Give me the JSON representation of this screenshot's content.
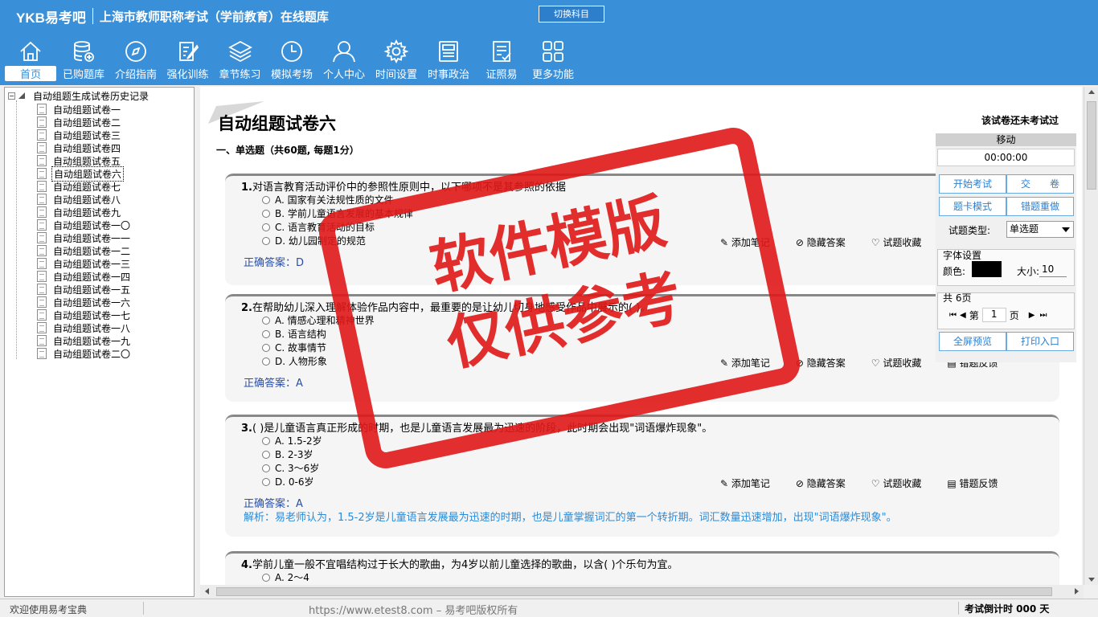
{
  "app": {
    "brand": "YKB易考吧",
    "title": "上海市教师职称考试（学前教育）在线题库",
    "switch_label": "切换科目"
  },
  "toolbar": [
    {
      "label": "首页",
      "icon": "home-icon"
    },
    {
      "label": "已购题库",
      "icon": "database-icon"
    },
    {
      "label": "介绍指南",
      "icon": "compass-icon"
    },
    {
      "label": "强化训练",
      "icon": "edit-icon"
    },
    {
      "label": "章节练习",
      "icon": "layers-icon"
    },
    {
      "label": "模拟考场",
      "icon": "clock-icon"
    },
    {
      "label": "个人中心",
      "icon": "user-icon"
    },
    {
      "label": "时间设置",
      "icon": "gear-icon"
    },
    {
      "label": "时事政治",
      "icon": "news-icon"
    },
    {
      "label": "证照易",
      "icon": "checklist-icon"
    },
    {
      "label": "更多功能",
      "icon": "grid-icon"
    }
  ],
  "tree": {
    "root": "自动组题生成试卷历史记录",
    "items": [
      "自动组题试卷一",
      "自动组题试卷二",
      "自动组题试卷三",
      "自动组题试卷四",
      "自动组题试卷五",
      "自动组题试卷六",
      "自动组题试卷七",
      "自动组题试卷八",
      "自动组题试卷九",
      "自动组题试卷一〇",
      "自动组题试卷一一",
      "自动组题试卷一二",
      "自动组题试卷一三",
      "自动组题试卷一四",
      "自动组题试卷一五",
      "自动组题试卷一六",
      "自动组题试卷一七",
      "自动组题试卷一八",
      "自动组题试卷一九",
      "自动组题试卷二〇"
    ],
    "selected_index": 5
  },
  "paper": {
    "title": "自动组题试卷六",
    "status": "该试卷还未考试过",
    "section": "一、单选题（共60题, 每题1分）"
  },
  "question_actions": {
    "note": "添加笔记",
    "hide": "隐藏答案",
    "fav": "试题收藏",
    "report": "错题反馈"
  },
  "questions": [
    {
      "num": "1.",
      "stem": "对语言教育活动评价中的参照性原则中，以下哪项不是其参照的依据",
      "options": [
        "A. 国家有关法规性质的文件",
        "B. 学前儿童语言发展的基本规律",
        "C. 语言教育活动的目标",
        "D. 幼儿园制定的规范"
      ],
      "answer_label": "正确答案：",
      "answer": "D",
      "explain": ""
    },
    {
      "num": "2.",
      "stem": "在帮助幼儿深入理解体验作品内容中，最重要的是让幼儿切身地感受作品中展示的( )。",
      "options": [
        "A. 情感心理和精神世界",
        "B. 语言结构",
        "C. 故事情节",
        "D. 人物形象"
      ],
      "answer_label": "正确答案：",
      "answer": "A",
      "explain": ""
    },
    {
      "num": "3.",
      "stem": "( )是儿童语言真正形成的时期，也是儿童语言发展最为迅速的阶段，此时期会出现\"词语爆炸现象\"。",
      "options": [
        "A. 1.5-2岁",
        "B. 2-3岁",
        "C. 3～6岁",
        "D. 0-6岁"
      ],
      "answer_label": "正确答案：",
      "answer": "A",
      "explain": "解析：易老师认为，1.5-2岁是儿童语言发展最为迅速的时期，也是儿童掌握词汇的第一个转折期。词汇数量迅速增加，出现\"词语爆炸现象\"。"
    },
    {
      "num": "4.",
      "stem": "学前儿童一般不宜唱结构过于长大的歌曲，为4岁以前儿童选择的歌曲，以含( )个乐句为宜。",
      "options": [
        "A. 2～4"
      ],
      "answer_label": "",
      "answer": "",
      "explain": ""
    }
  ],
  "panel": {
    "move": "移动",
    "timer": "00:00:00",
    "start": "开始考试",
    "submit": "交　　卷",
    "card_mode": "题卡模式",
    "redo": "错题重做",
    "type_label": "试题类型:",
    "type_value": "单选题",
    "font_title": "字体设置",
    "color_label": "颜色:",
    "size_label": "大小:",
    "size_value": "10",
    "pages_title": "共 6页",
    "page_prefix": "第",
    "page_value": "1",
    "page_suffix": "页",
    "fullscreen": "全屏预览",
    "print": "打印入口",
    "font_color": "#000000"
  },
  "watermark": {
    "line1": "软件模版",
    "line2": "仅供参考"
  },
  "status": {
    "welcome": "欢迎使用易考宝典",
    "copyright": "https://www.etest8.com – 易考吧版权所有",
    "countdown": "考试倒计时 000 天"
  },
  "colors": {
    "header": "#3a8fd9",
    "answer": "#2b4ea8",
    "explain": "#2c8ad6",
    "watermark": "#e01818"
  }
}
